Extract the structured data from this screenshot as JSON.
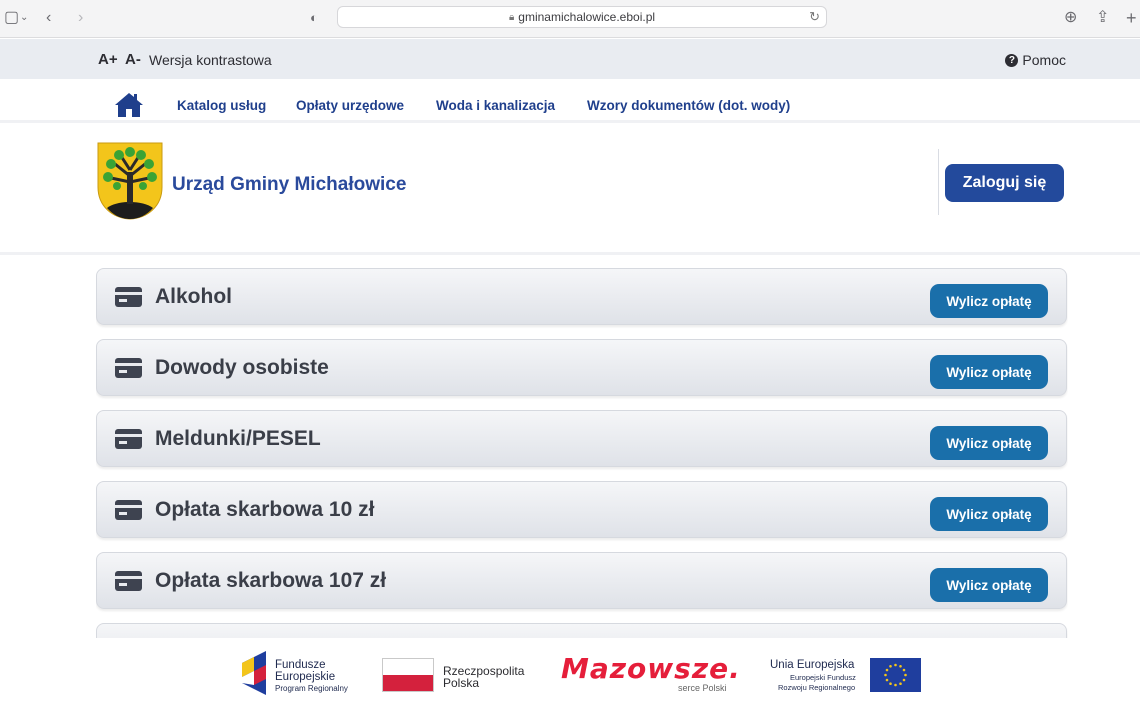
{
  "browser": {
    "url": "gminamichalowice.eboi.pl"
  },
  "a11y": {
    "font_plus": "A+",
    "font_minus": "A-",
    "contrast_label": "Wersja kontrastowa",
    "help_label": "Pomoc"
  },
  "nav": {
    "items": [
      {
        "label": "Katalog usług"
      },
      {
        "label": "Opłaty urzędowe"
      },
      {
        "label": "Woda i kanalizacja"
      },
      {
        "label": "Wzory dokumentów (dot. wody)"
      }
    ]
  },
  "header": {
    "org_name": "Urząd Gminy Michałowice",
    "login_label": "Zaloguj się"
  },
  "fees": {
    "button_label": "Wylicz opłatę",
    "items": [
      {
        "title": "Alkohol"
      },
      {
        "title": "Dowody osobiste"
      },
      {
        "title": "Meldunki/PESEL"
      },
      {
        "title": "Opłata skarbowa 10 zł"
      },
      {
        "title": "Opłata skarbowa 107 zł"
      }
    ]
  },
  "footer": {
    "fe_line1": "Fundusze",
    "fe_line2": "Europejskie",
    "fe_line3": "Program Regionalny",
    "rp_line1": "Rzeczpospolita",
    "rp_line2": "Polska",
    "maz_logo": "Mazowsze.",
    "maz_sub": "serce Polski",
    "ue_line1": "Unia Europejska",
    "ue_line2": "Europejski Fundusz",
    "ue_line3": "Rozwoju Regionalnego"
  },
  "colors": {
    "nav_text": "#1f3f8c",
    "login_bg": "#234a9c",
    "calc_btn_bg": "#1a6faa"
  }
}
